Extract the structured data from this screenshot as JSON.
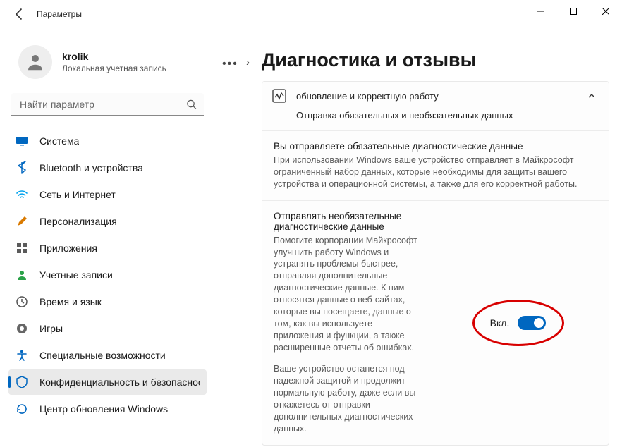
{
  "window": {
    "title": "Параметры"
  },
  "profile": {
    "name": "krolik",
    "sub": "Локальная учетная запись"
  },
  "search": {
    "placeholder": "Найти параметр"
  },
  "nav": {
    "system": "Система",
    "bluetooth": "Bluetooth и устройства",
    "network": "Сеть и Интернет",
    "personalization": "Персонализация",
    "apps": "Приложения",
    "accounts": "Учетные записи",
    "time": "Время и язык",
    "gaming": "Игры",
    "accessibility": "Специальные возможности",
    "privacy": "Конфиденциальность и безопасность",
    "update": "Центр обновления Windows"
  },
  "page": {
    "title": "Диагностика и отзывы",
    "card_hd_line": "обновление и корректную работу",
    "card_sub": "Отправка обязательных и необязательных данных",
    "sec1_title": "Вы отправляете обязательные диагностические данные",
    "sec1_body": "При использовании Windows ваше устройство отправляет в Майкрософт ограниченный набор данных, которые необходимы для защиты вашего устройства и операционной системы, а также для его корректной работы.",
    "sec2_title": "Отправлять необязательные диагностические данные",
    "sec2_body": "Помогите корпорации Майкрософт улучшить работу Windows и устранять проблемы быстрее, отправляя дополнительные диагностические данные. К ним относятся данные о веб-сайтах, которые вы посещаете, данные о том, как вы используете приложения и функции, а также расширенные отчеты об ошибках.",
    "sec2_body2": "Ваше устройство останется под надежной защитой и продолжит нормальную работу, даже если вы откажетесь от отправки дополнительных диагностических данных.",
    "toggle_label": "Вкл.",
    "toggle_state": "on"
  }
}
